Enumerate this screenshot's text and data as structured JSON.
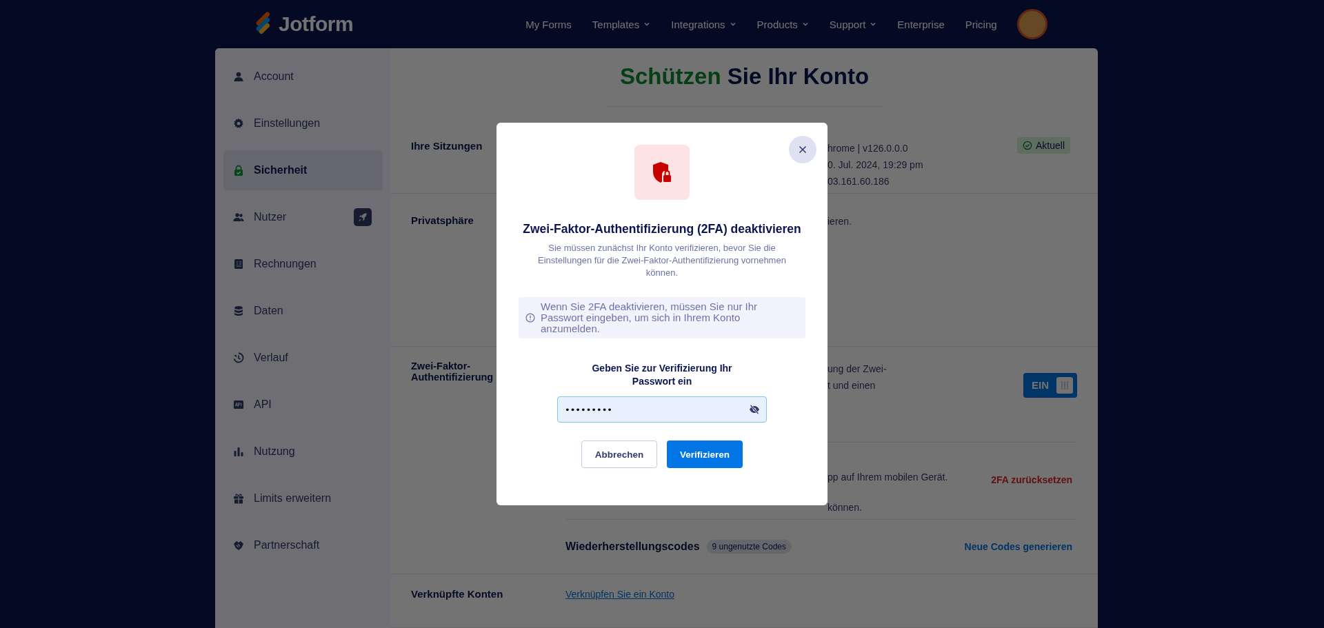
{
  "header": {
    "logo": "Jotform",
    "nav": [
      {
        "label": "My Forms",
        "dropdown": false
      },
      {
        "label": "Templates",
        "dropdown": true
      },
      {
        "label": "Integrations",
        "dropdown": true
      },
      {
        "label": "Products",
        "dropdown": true
      },
      {
        "label": "Support",
        "dropdown": true
      },
      {
        "label": "Enterprise",
        "dropdown": false
      },
      {
        "label": "Pricing",
        "dropdown": false
      }
    ]
  },
  "sidebar": {
    "items": [
      {
        "label": "Account",
        "selected": false,
        "badge": false
      },
      {
        "label": "Einstellungen",
        "selected": false,
        "badge": false
      },
      {
        "label": "Sicherheit",
        "selected": true,
        "badge": false
      },
      {
        "label": "Nutzer",
        "selected": false,
        "badge": true
      },
      {
        "label": "Rechnungen",
        "selected": false,
        "badge": false
      },
      {
        "label": "Daten",
        "selected": false,
        "badge": false
      },
      {
        "label": "Verlauf",
        "selected": false,
        "badge": false
      },
      {
        "label": "API",
        "selected": false,
        "badge": false
      },
      {
        "label": "Nutzung",
        "selected": false,
        "badge": false
      },
      {
        "label": "Limits erweitern",
        "selected": false,
        "badge": false
      },
      {
        "label": "Partnerschaft",
        "selected": false,
        "badge": false
      }
    ]
  },
  "page": {
    "title_highlight": "Schützen",
    "title_rest": "Sie Ihr Konto",
    "sessions": {
      "label": "Ihre Sitzungen",
      "lines": [
        "hrome | v126.0.0.0",
        "0. Jul. 2024, 19:29 pm",
        "03.161.60.186"
      ],
      "badge": "Aktuell"
    },
    "privacy": {
      "label": "Privatsphäre",
      "lines": [
        "ieren."
      ]
    },
    "two_factor": {
      "label": "Zwei-Faktor-Authentifizierung",
      "lines": [
        "ung der Zwei-",
        "t und einen"
      ],
      "toggle": {
        "label": "EIN",
        "on": true
      },
      "app": {
        "lines": [
          "pp auf Ihrem mobilen Gerät."
        ],
        "tail": "können.",
        "action": "2FA zurücksetzen"
      },
      "recovery": {
        "label": "Wiederherstellungscodes",
        "count": "9 ungenutzte Codes",
        "action": "Neue Codes generieren"
      }
    },
    "linked": {
      "label": "Verknüpfte Konten",
      "link": "Verknüpfen Sie ein Konto"
    }
  },
  "modal": {
    "title": "Zwei-Faktor-Authentifizierung (2FA) deaktivieren",
    "subtitle": "Sie müssen zunächst Ihr Konto verifizieren, bevor Sie die Einstellungen für die Zwei-Faktor-Authentifizierung vornehmen können.",
    "notice": "Wenn Sie 2FA deaktivieren, müssen Sie nur Ihr Passwort eingeben, um sich in Ihrem Konto anzumelden.",
    "field_label": "Geben Sie zur Verifizierung Ihr Passwort ein",
    "password": "•••••••••",
    "buttons": [
      {
        "label": "Abbrechen",
        "kind": "secondary"
      },
      {
        "label": "Verifizieren",
        "kind": "primary"
      }
    ]
  }
}
